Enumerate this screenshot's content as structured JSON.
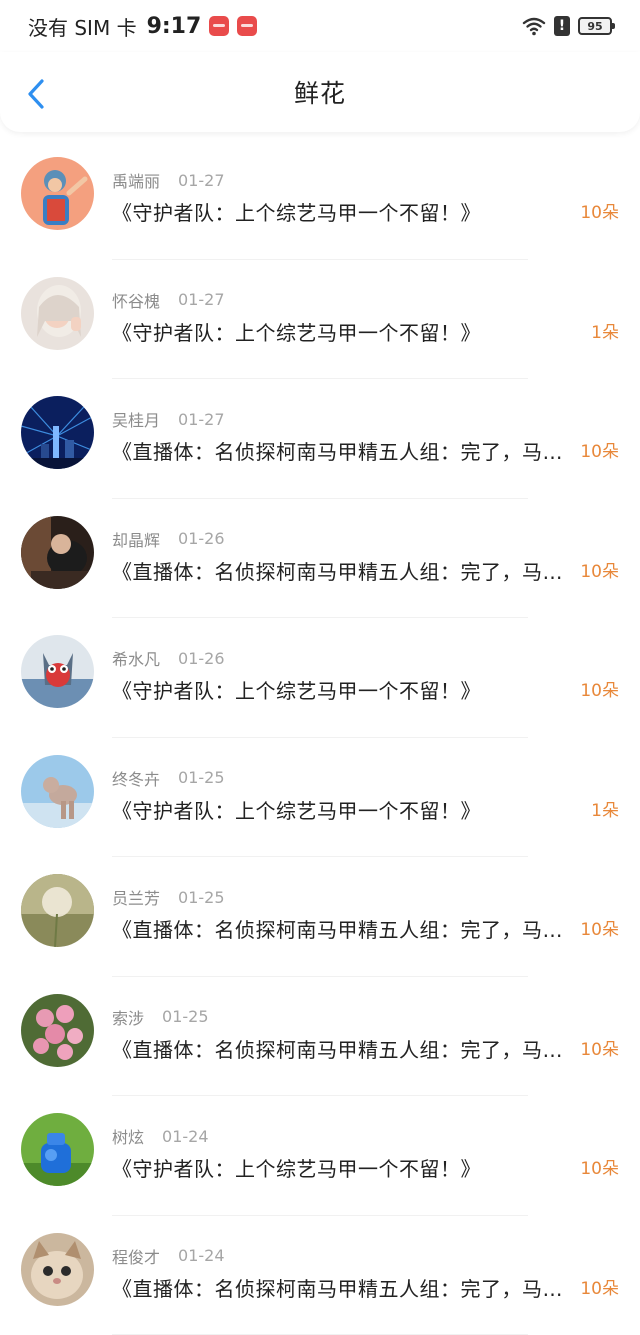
{
  "status_bar": {
    "carrier": "没有 SIM 卡",
    "time": "9:17",
    "battery": "95"
  },
  "header": {
    "title": "鲜花"
  },
  "items": [
    {
      "name": "禹端丽",
      "date": "01-27",
      "title": "《守护者队：上个综艺马甲一个不留！》",
      "count": "10朵"
    },
    {
      "name": "怀谷槐",
      "date": "01-27",
      "title": "《守护者队：上个综艺马甲一个不留！》",
      "count": "1朵"
    },
    {
      "name": "吴桂月",
      "date": "01-27",
      "title": "《直播体：名侦探柯南马甲精五人组：完了，马…",
      "count": "10朵"
    },
    {
      "name": "却晶辉",
      "date": "01-26",
      "title": "《直播体：名侦探柯南马甲精五人组：完了，马…",
      "count": "10朵"
    },
    {
      "name": "希水凡",
      "date": "01-26",
      "title": "《守护者队：上个综艺马甲一个不留！》",
      "count": "10朵"
    },
    {
      "name": "终冬卉",
      "date": "01-25",
      "title": "《守护者队：上个综艺马甲一个不留！》",
      "count": "1朵"
    },
    {
      "name": "员兰芳",
      "date": "01-25",
      "title": "《直播体：名侦探柯南马甲精五人组：完了，马…",
      "count": "10朵"
    },
    {
      "name": "索涉",
      "date": "01-25",
      "title": "《直播体：名侦探柯南马甲精五人组：完了，马…",
      "count": "10朵"
    },
    {
      "name": "树炫",
      "date": "01-24",
      "title": "《守护者队：上个综艺马甲一个不留！》",
      "count": "10朵"
    },
    {
      "name": "程俊才",
      "date": "01-24",
      "title": "《直播体：名侦探柯南马甲精五人组：完了，马…",
      "count": "10朵"
    }
  ],
  "colors": {
    "accent": "#2e8ff0",
    "count": "#e8883a"
  }
}
